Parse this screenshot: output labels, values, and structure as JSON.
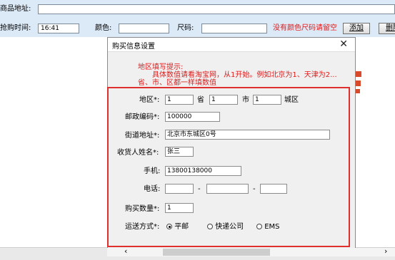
{
  "toolbar": {
    "product_url_label": "商品地址:",
    "buy_time_label": "抢购时间:",
    "buy_time_value": "16:41",
    "color_label": "颜色:",
    "size_label": "尺码:",
    "no_color_note": "没有颜色尺码请留空",
    "add_button": "添加",
    "delete_button": "删除"
  },
  "dialog": {
    "title": "购买信息设置",
    "hint_title": "地区填写提示:",
    "hint_line1": "具体数值请看淘宝网，从1开始。例如北京为1、天津为2...",
    "hint_line2": "省、市、区都一样填数值",
    "region_label": "地区*:",
    "province_value": "1",
    "province_unit": "省",
    "city_value": "1",
    "city_unit": "市",
    "district_value": "1",
    "district_unit": "城区",
    "postcode_label": "邮政编码*:",
    "postcode_value": "100000",
    "street_label": "街道地址*:",
    "street_value": "北京市东城区0号",
    "receiver_label": "收货人姓名*:",
    "receiver_value": "张三",
    "mobile_label": "手机:",
    "mobile_value": "13800138000",
    "phone_label": "电话:",
    "phone_sep": "-",
    "quantity_label": "购买数量*:",
    "quantity_value": "1",
    "shipping_label": "运送方式*:",
    "shipping_options": [
      "平邮",
      "快递公司",
      "EMS"
    ],
    "shipping_selected": "平邮"
  },
  "colors": {
    "accent_red": "#e0302d",
    "hint_red": "#e01b1b"
  }
}
